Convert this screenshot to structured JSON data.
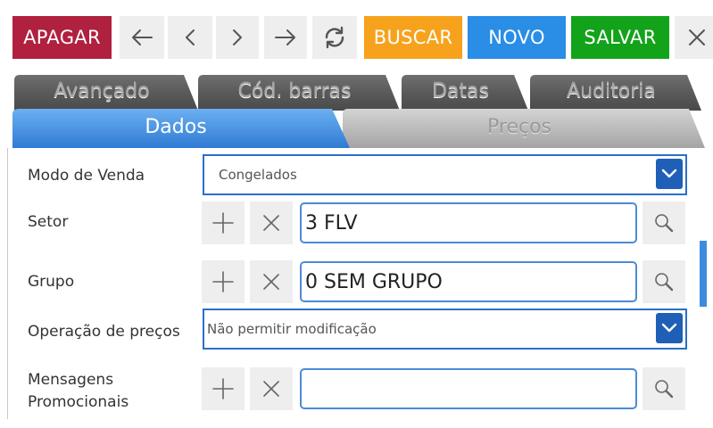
{
  "toolbar": {
    "apagar_label": "APAGAR",
    "buscar_label": "BUSCAR",
    "novo_label": "NOVO",
    "salvar_label": "SALVAR",
    "colors": {
      "apagar": "#b0203f",
      "buscar": "#f7a21c",
      "novo": "#2a8de6",
      "salvar": "#13a31b"
    }
  },
  "tabs": {
    "back": [
      {
        "label": "Avançado"
      },
      {
        "label": "Cód. barras"
      },
      {
        "label": "Datas"
      },
      {
        "label": "Auditoria"
      }
    ],
    "front": [
      {
        "label": "Dados",
        "active": true
      },
      {
        "label": "Preços",
        "active": false
      }
    ]
  },
  "form": {
    "modo_venda": {
      "label": "Modo de Venda",
      "value": "Congelados"
    },
    "setor": {
      "label": "Setor",
      "value": "3 FLV"
    },
    "grupo": {
      "label": "Grupo",
      "value": "0 SEM GRUPO"
    },
    "operacao_precos": {
      "label": "Operação de preços",
      "value": "Não permitir modificação"
    },
    "mensagens": {
      "label_line1": "Mensagens",
      "label_line2": "Promocionais",
      "value": ""
    }
  }
}
